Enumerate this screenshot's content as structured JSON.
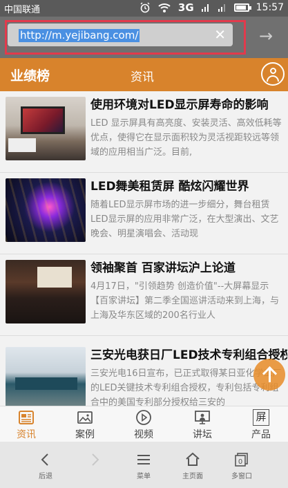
{
  "status_bar": {
    "carrier": "中国联通",
    "network": "3G",
    "time": "15:57"
  },
  "address_bar": {
    "url": "http://m.yejibang.com/"
  },
  "top_nav": {
    "brand": "业绩榜",
    "tab": "资讯"
  },
  "articles": [
    {
      "title": "使用环境对LED显示屏寿命的影响",
      "summary": "LED 显示屏具有高亮度、安装灵活、高效低耗等优点，使得它在显示面积较为灵活视距较远等领域的应用相当广泛。目前,"
    },
    {
      "title": "LED舞美租赁屏 酷炫闪耀世界",
      "summary": "随着LED显示屏市场的进一步细分，舞台租赁LED显示屏的应用非常广泛，在大型演出、文艺晚会、明星演唱会、活动现"
    },
    {
      "title": "领袖聚首 百家讲坛沪上论道",
      "summary": "4月17日，\"引领趋势 创造价值\"--大屏幕显示【百家讲坛】第二季全国巡讲活动来到上海，与上海及华东区域的200名行业人"
    },
    {
      "title": "三安光电获日厂LED技术专利组合授权",
      "summary": "三安光电16日宣布，已正式取得某日亚化学工厂的LED关键技术专利组合授权，专利包括专利组合中的美国专利部分授权给三安的"
    }
  ],
  "tab_bar": {
    "items": [
      {
        "label": "资讯",
        "icon": "news-icon"
      },
      {
        "label": "案例",
        "icon": "image-icon"
      },
      {
        "label": "视频",
        "icon": "play-icon"
      },
      {
        "label": "讲坛",
        "icon": "presenter-icon"
      },
      {
        "label": "产品",
        "icon": "screen-icon"
      }
    ],
    "product_glyph": "屏"
  },
  "system_nav": {
    "back": "后退",
    "menu": "菜单",
    "home": "主页面",
    "windows": "多窗口",
    "windows_count": "0"
  },
  "colors": {
    "accent": "#d8832c",
    "highlight_border": "#e23a4c",
    "url_selection": "#4a90e2"
  }
}
